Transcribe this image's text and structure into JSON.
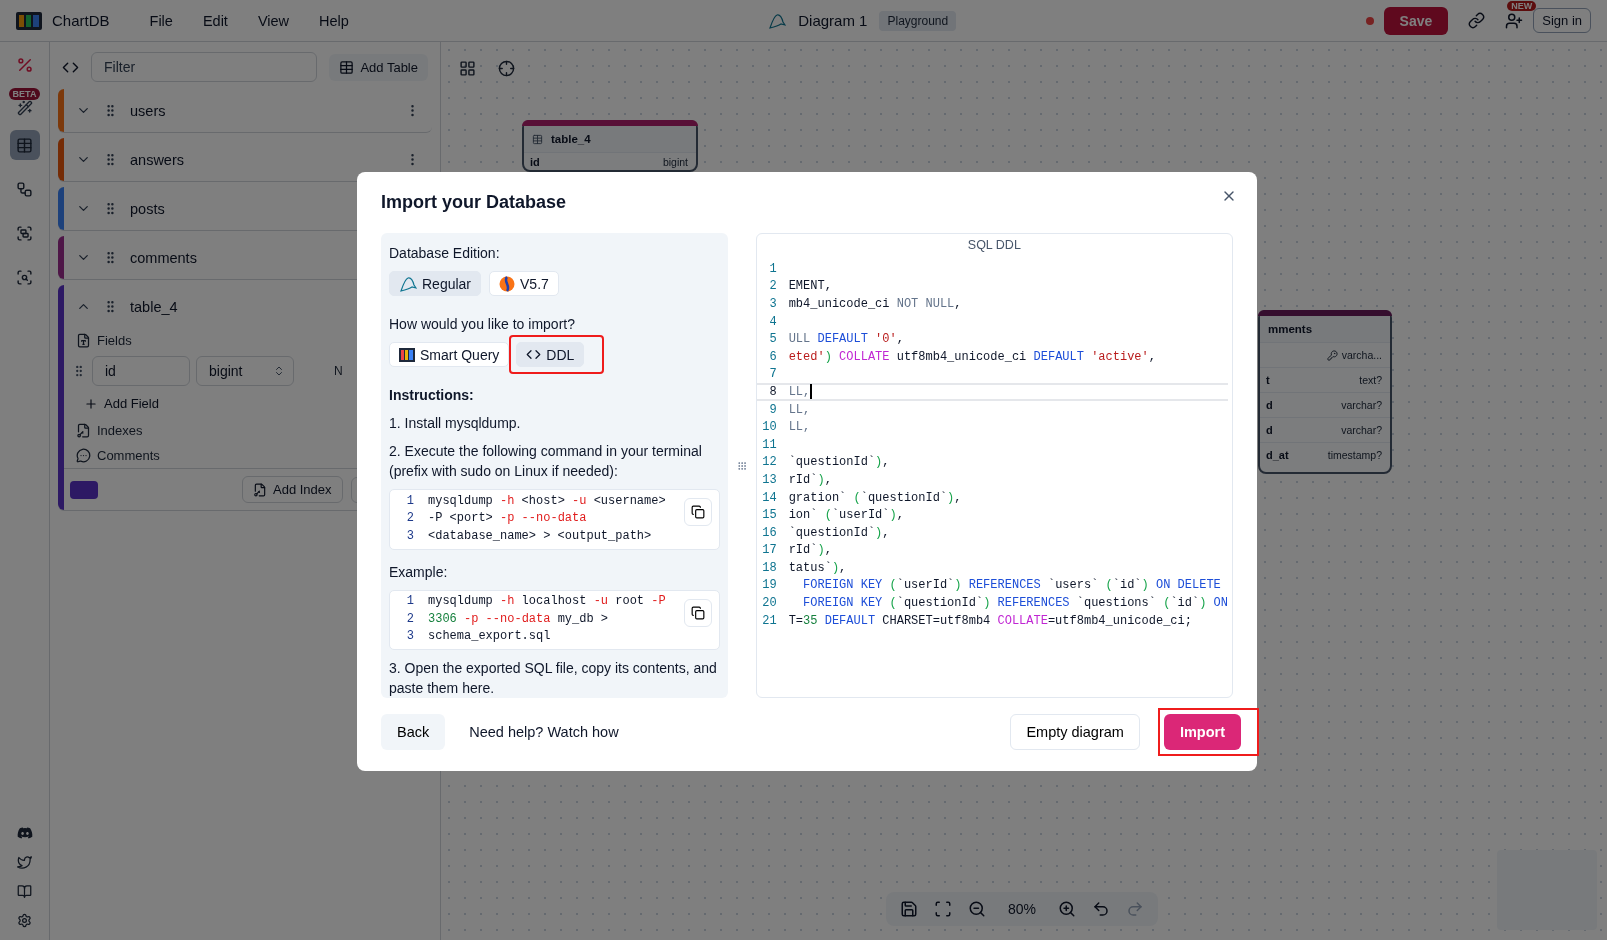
{
  "app": {
    "name": "ChartDB",
    "menu": [
      "File",
      "Edit",
      "View",
      "Help"
    ]
  },
  "diagram": {
    "title": "Diagram 1",
    "badge": "Playground",
    "unsaved": true
  },
  "actions": {
    "save": "Save",
    "new_badge": "NEW",
    "sign_in": "Sign in"
  },
  "rail": {
    "beta_badge": "BETA",
    "items": [
      {
        "kind": "tables",
        "selected": true
      },
      {
        "kind": "relationships",
        "selected": false
      },
      {
        "kind": "areas",
        "selected": false
      },
      {
        "kind": "scan",
        "selected": false
      }
    ]
  },
  "sidebar": {
    "filter_placeholder": "Filter",
    "add_table": "Add Table",
    "tables": [
      {
        "name": "users",
        "color": "#7c390b",
        "expanded": false
      },
      {
        "name": "answers",
        "color": "#752c06",
        "expanded": false
      },
      {
        "name": "posts",
        "color": "#1d417b",
        "expanded": false
      },
      {
        "name": "comments",
        "color": "#4e1647",
        "expanded": false
      },
      {
        "name": "table_4",
        "color": "#2d1964",
        "expanded": true,
        "fields_label": "Fields",
        "fields": [
          {
            "name": "id",
            "type": "bigint",
            "nullable": "N"
          }
        ],
        "add_field": "Add Field",
        "indexes": "Indexes",
        "comments": "Comments",
        "add_index": "Add Index"
      }
    ]
  },
  "canvas": {
    "nodes": [
      {
        "name": "table_4",
        "color": "#581037",
        "fields": [
          {
            "name": "id",
            "type": "bigint",
            "key": false
          }
        ]
      },
      {
        "name": "mments",
        "color": "#350e2e",
        "fields": [
          {
            "type": "varcha...",
            "key": true
          },
          {
            "name": "t",
            "type": "text?",
            "key": false
          },
          {
            "name": "d",
            "type": "varchar?",
            "key": false
          },
          {
            "name": "d",
            "type": "varchar?",
            "key": false
          },
          {
            "name": "d_at",
            "type": "timestamp?",
            "key": false
          }
        ]
      }
    ],
    "zoom": "80%"
  },
  "modal": {
    "title": "Import your Database",
    "edition_label": "Database Edition:",
    "editions": [
      {
        "label": "Regular",
        "kind": "mysql",
        "selected": true
      },
      {
        "label": "V5.7",
        "kind": "version",
        "selected": false
      }
    ],
    "method_label": "How would you like to import?",
    "methods": [
      {
        "label": "Smart Query",
        "kind": "smart",
        "selected": false,
        "highlighted": false
      },
      {
        "label": "DDL",
        "kind": "ddl",
        "selected": true,
        "highlighted": true
      }
    ],
    "instructions_title": "Instructions:",
    "step_1": "1. Install mysqldump.",
    "step_2": "2. Execute the following command in your terminal (prefix with sudo on Linux if needed):",
    "command": [
      {
        "n": "1",
        "tokens": [
          {
            "text": "mysqldump",
            "kind": "plain"
          },
          {
            "text": " -h",
            "kind": "flag"
          },
          {
            "text": " <host>",
            "kind": "plain"
          },
          {
            "text": " -u",
            "kind": "flag"
          },
          {
            "text": " <username>",
            "kind": "plain"
          }
        ]
      },
      {
        "n": "2",
        "tokens": [
          {
            "text": "-P <port>",
            "kind": "plain"
          },
          {
            "text": " -p",
            "kind": "flag"
          },
          {
            "text": " --no-data",
            "kind": "flag"
          }
        ]
      },
      {
        "n": "3",
        "tokens": [
          {
            "text": "<database_name> > <output_path>",
            "kind": "plain"
          }
        ]
      }
    ],
    "example_label": "Example:",
    "example": [
      {
        "n": "1",
        "tokens": [
          {
            "text": "mysqldump",
            "kind": "plain"
          },
          {
            "text": " -h",
            "kind": "flag"
          },
          {
            "text": " localhost",
            "kind": "plain"
          },
          {
            "text": " -u",
            "kind": "flag"
          },
          {
            "text": " root",
            "kind": "plain"
          },
          {
            "text": " -P",
            "kind": "flag"
          }
        ]
      },
      {
        "n": "2",
        "tokens": [
          {
            "text": "3306",
            "kind": "number"
          },
          {
            "text": " -p",
            "kind": "flag"
          },
          {
            "text": " --no-data",
            "kind": "flag"
          },
          {
            "text": " my_db >",
            "kind": "plain"
          }
        ]
      },
      {
        "n": "3",
        "tokens": [
          {
            "text": "schema_export.sql",
            "kind": "plain"
          }
        ]
      }
    ],
    "step_3": "3. Open the exported SQL file, copy its contents, and paste them here.",
    "editor_title": "SQL DDL",
    "sql": [
      {
        "n": "1",
        "current": false
      },
      {
        "n": "2",
        "current": false,
        "tokens": [
          {
            "text": "EMENT,",
            "kind": "plain"
          }
        ]
      },
      {
        "n": "3",
        "current": false,
        "tokens": [
          {
            "text": "mb4_unicode_ci",
            "kind": "plain"
          },
          {
            "text": " NOT NULL",
            "kind": "muted"
          },
          {
            "text": ",",
            "kind": "plain"
          }
        ]
      },
      {
        "n": "4",
        "current": false
      },
      {
        "n": "5",
        "current": false,
        "tokens": [
          {
            "text": "ULL",
            "kind": "muted"
          },
          {
            "text": " DEFAULT",
            "kind": "keyword"
          },
          {
            "text": " '0'",
            "kind": "string"
          },
          {
            "text": ",",
            "kind": "plain"
          }
        ]
      },
      {
        "n": "6",
        "current": false,
        "tokens": [
          {
            "text": "eted'",
            "kind": "string"
          },
          {
            "text": ")",
            "kind": "punct"
          },
          {
            "text": " COLLATE",
            "kind": "func"
          },
          {
            "text": " utf8mb4_unicode_ci",
            "kind": "plain"
          },
          {
            "text": " DEFAULT",
            "kind": "keyword"
          },
          {
            "text": " 'active'",
            "kind": "string"
          },
          {
            "text": ",",
            "kind": "plain"
          }
        ]
      },
      {
        "n": "7",
        "current": false
      },
      {
        "n": "8",
        "current": true,
        "tokens": [
          {
            "text": "LL,",
            "kind": "muted"
          }
        ]
      },
      {
        "n": "9",
        "current": false,
        "tokens": [
          {
            "text": "LL,",
            "kind": "muted"
          }
        ]
      },
      {
        "n": "10",
        "current": false,
        "tokens": [
          {
            "text": "LL,",
            "kind": "muted"
          }
        ]
      },
      {
        "n": "11",
        "current": false
      },
      {
        "n": "12",
        "current": false,
        "tokens": [
          {
            "text": "`questionId`",
            "kind": "plain"
          },
          {
            "text": ")",
            "kind": "punct"
          },
          {
            "text": ",",
            "kind": "plain"
          }
        ]
      },
      {
        "n": "13",
        "current": false,
        "tokens": [
          {
            "text": "rId`",
            "kind": "plain"
          },
          {
            "text": ")",
            "kind": "punct"
          },
          {
            "text": ",",
            "kind": "plain"
          }
        ]
      },
      {
        "n": "14",
        "current": false,
        "tokens": [
          {
            "text": "gration`",
            "kind": "plain"
          },
          {
            "text": " (",
            "kind": "punct"
          },
          {
            "text": "`questionId`",
            "kind": "plain"
          },
          {
            "text": ")",
            "kind": "punct"
          },
          {
            "text": ",",
            "kind": "plain"
          }
        ]
      },
      {
        "n": "15",
        "current": false,
        "tokens": [
          {
            "text": "ion`",
            "kind": "plain"
          },
          {
            "text": " (",
            "kind": "punct"
          },
          {
            "text": "`userId`",
            "kind": "plain"
          },
          {
            "text": ")",
            "kind": "punct"
          },
          {
            "text": ",",
            "kind": "plain"
          }
        ]
      },
      {
        "n": "16",
        "current": false,
        "tokens": [
          {
            "text": "`questionId`",
            "kind": "plain"
          },
          {
            "text": ")",
            "kind": "punct"
          },
          {
            "text": ",",
            "kind": "plain"
          }
        ]
      },
      {
        "n": "17",
        "current": false,
        "tokens": [
          {
            "text": "rId`",
            "kind": "plain"
          },
          {
            "text": ")",
            "kind": "punct"
          },
          {
            "text": ",",
            "kind": "plain"
          }
        ]
      },
      {
        "n": "18",
        "current": false,
        "tokens": [
          {
            "text": "tatus`",
            "kind": "plain"
          },
          {
            "text": ")",
            "kind": "punct"
          },
          {
            "text": ",",
            "kind": "plain"
          }
        ]
      },
      {
        "n": "19",
        "current": false,
        "tokens": [
          {
            "text": "  FOREIGN KEY",
            "kind": "keyword"
          },
          {
            "text": " (",
            "kind": "punct"
          },
          {
            "text": "`userId`",
            "kind": "plain"
          },
          {
            "text": ")",
            "kind": "punct"
          },
          {
            "text": " REFERENCES",
            "kind": "keyword"
          },
          {
            "text": " `users`",
            "kind": "plain"
          },
          {
            "text": " (",
            "kind": "punct"
          },
          {
            "text": "`id`",
            "kind": "plain"
          },
          {
            "text": ")",
            "kind": "punct"
          },
          {
            "text": " ON DELETE",
            "kind": "keyword"
          }
        ]
      },
      {
        "n": "20",
        "current": false,
        "tokens": [
          {
            "text": "  FOREIGN KEY",
            "kind": "keyword"
          },
          {
            "text": " (",
            "kind": "punct"
          },
          {
            "text": "`questionId`",
            "kind": "plain"
          },
          {
            "text": ")",
            "kind": "punct"
          },
          {
            "text": " REFERENCES",
            "kind": "keyword"
          },
          {
            "text": " `questions`",
            "kind": "plain"
          },
          {
            "text": " (",
            "kind": "punct"
          },
          {
            "text": "`id`",
            "kind": "plain"
          },
          {
            "text": ")",
            "kind": "punct"
          },
          {
            "text": " ON",
            "kind": "keyword"
          }
        ]
      },
      {
        "n": "21",
        "current": false,
        "tokens": [
          {
            "text": "T=",
            "kind": "plain"
          },
          {
            "text": "35",
            "kind": "number"
          },
          {
            "text": " DEFAULT",
            "kind": "keyword"
          },
          {
            "text": " CHARSET=utf8mb4",
            "kind": "plain"
          },
          {
            "text": " COLLATE",
            "kind": "func"
          },
          {
            "text": "=utf8mb4_unicode_ci;",
            "kind": "plain"
          }
        ]
      }
    ],
    "back": "Back",
    "help": "Need help? Watch how",
    "empty": "Empty diagram",
    "import": {
      "label": "Import",
      "highlighted": true
    }
  }
}
